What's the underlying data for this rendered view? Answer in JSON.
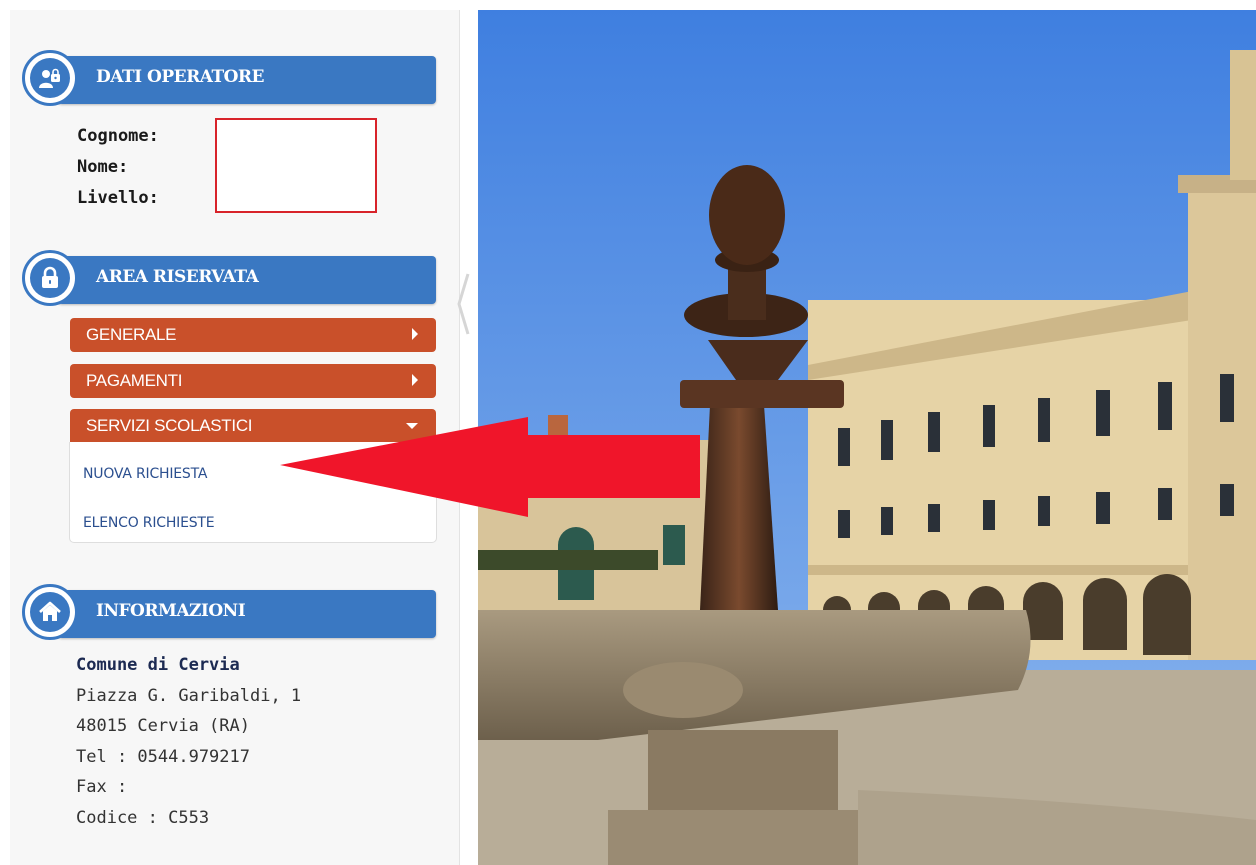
{
  "operator_section": {
    "title": "DATI OPERATORE",
    "icon": "operator-icon",
    "fields": [
      {
        "label": "Cognome:",
        "value": ""
      },
      {
        "label": "Nome:",
        "value": ""
      },
      {
        "label": "Livello:",
        "value": ""
      }
    ]
  },
  "reserved_section": {
    "title": "AREA RISERVATA",
    "icon": "lock-icon",
    "menu": [
      {
        "label": "GENERALE",
        "caret": "chevron-right-icon"
      },
      {
        "label": "PAGAMENTI",
        "caret": "chevron-right-icon"
      },
      {
        "label": "SERVIZI SCOLASTICI",
        "caret": "chevron-down-icon",
        "submenu": [
          "NUOVA RICHIESTA",
          "ELENCO RICHIESTE"
        ]
      }
    ]
  },
  "info_section": {
    "title": "INFORMAZIONI",
    "icon": "home-icon",
    "lines": [
      "Comune di Cervia",
      "Piazza G. Garibaldi, 1",
      "48015 Cervia (RA)",
      "Tel : 0544.979217",
      "Fax :",
      "Codice : C553"
    ]
  },
  "colors": {
    "header_blue": "#3a78c2",
    "menu_orange": "#c9502a",
    "annotation_red": "#f0152a",
    "link_blue": "#2b4f8f"
  }
}
